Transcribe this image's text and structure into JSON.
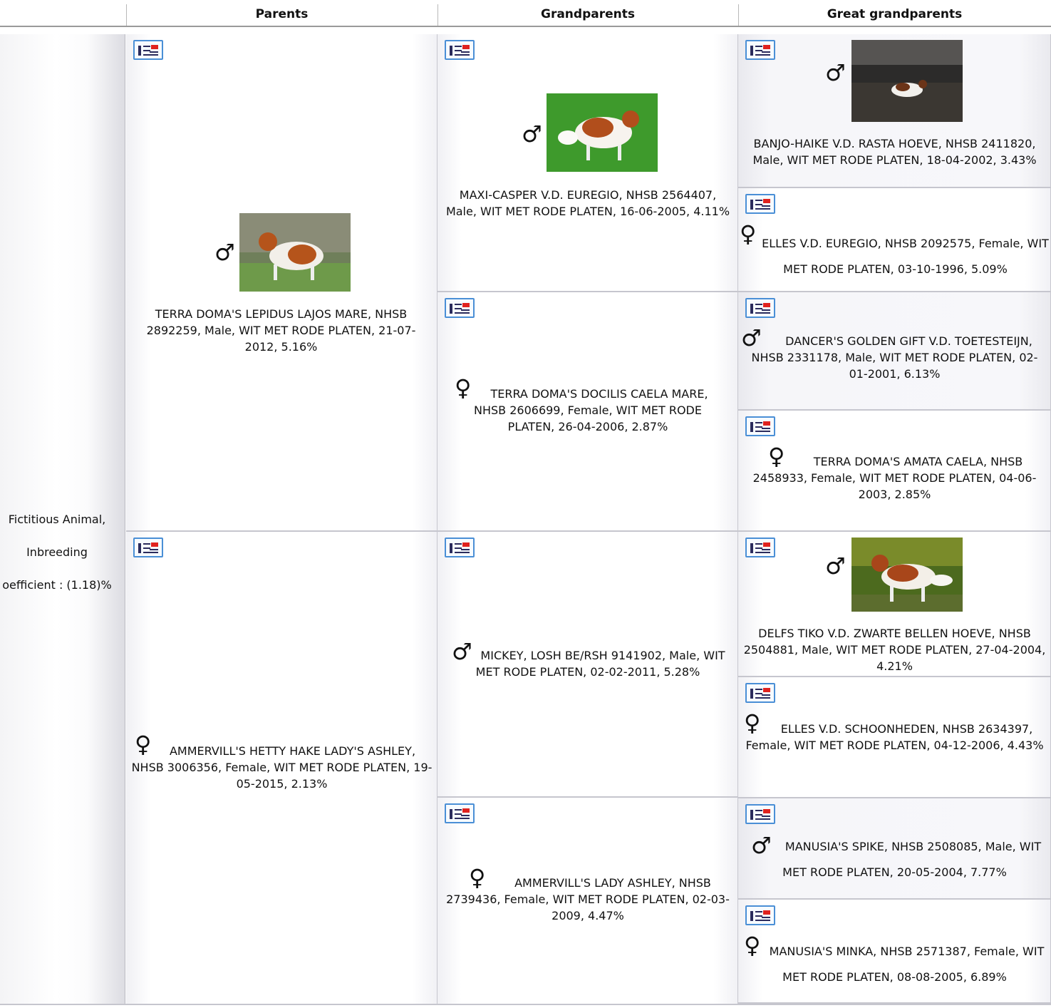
{
  "headers": {
    "parents": "Parents",
    "grandparents": "Grandparents",
    "great_grandparents": "Great grandparents"
  },
  "subject": {
    "line1": "Fictitious Animal,",
    "line2": "Inbreeding",
    "line3": "oefficient : (1.18)%"
  },
  "symbols": {
    "male": "♂",
    "female": "♀"
  },
  "icons": {
    "card": "pedigree-card-icon",
    "male": "male-symbol-icon",
    "female": "female-symbol-icon"
  },
  "parents": {
    "sire": {
      "text": "TERRA DOMA'S LEPIDUS LAJOS MARE, NHSB 2892259, Male, WIT MET RODE PLATEN, 21-07-2012, 5.16%"
    },
    "dam": {
      "text": "AMMERVILL'S HETTY HAKE LADY'S ASHLEY, NHSB 3006356, Female, WIT MET RODE PLATEN, 19-05-2015, 2.13%"
    }
  },
  "grandparents": {
    "ss": {
      "text": "MAXI-CASPER V.D. EUREGIO, NHSB 2564407, Male, WIT MET RODE PLATEN, 16-06-2005, 4.11%"
    },
    "sd": {
      "text": "TERRA DOMA'S DOCILIS CAELA MARE, NHSB 2606699, Female, WIT MET RODE PLATEN, 26-04-2006, 2.87%"
    },
    "ds": {
      "text": "MICKEY, LOSH BE/RSH 9141902, Male, WIT MET RODE PLATEN, 02-02-2011, 5.28%"
    },
    "dd": {
      "text": "AMMERVILL'S LADY ASHLEY, NHSB 2739436, Female, WIT MET RODE PLATEN, 02-03-2009, 4.47%"
    }
  },
  "great_grandparents": {
    "sss": {
      "text": "BANJO-HAIKE V.D. RASTA HOEVE, NHSB 2411820, Male, WIT MET RODE PLATEN, 18-04-2002, 3.43%"
    },
    "ssd": {
      "text": "ELLES V.D. EUREGIO, NHSB 2092575, Female, WIT MET RODE PLATEN, 03-10-1996, 5.09%"
    },
    "sds": {
      "text": "DANCER'S GOLDEN GIFT V.D. TOETESTEIJN, NHSB 2331178, Male, WIT MET RODE PLATEN, 02-01-2001, 6.13%"
    },
    "sdd": {
      "text": "TERRA DOMA'S AMATA CAELA, NHSB 2458933, Female, WIT MET RODE PLATEN, 04-06-2003, 2.85%"
    },
    "dss": {
      "text": "DELFS TIKO V.D. ZWARTE BELLEN HOEVE, NHSB 2504881, Male, WIT MET RODE PLATEN, 27-04-2004, 4.21%"
    },
    "dsd": {
      "text": "ELLES V.D. SCHOONHEDEN, NHSB 2634397, Female, WIT MET RODE PLATEN, 04-12-2006, 4.43%"
    },
    "dds": {
      "text": "MANUSIA'S SPIKE, NHSB 2508085, Male, WIT MET RODE PLATEN, 20-05-2004, 7.77%"
    },
    "ddd": {
      "text": "MANUSIA'S MINKA, NHSB 2571387, Female, WIT MET RODE PLATEN, 08-08-2005, 6.89%"
    }
  }
}
